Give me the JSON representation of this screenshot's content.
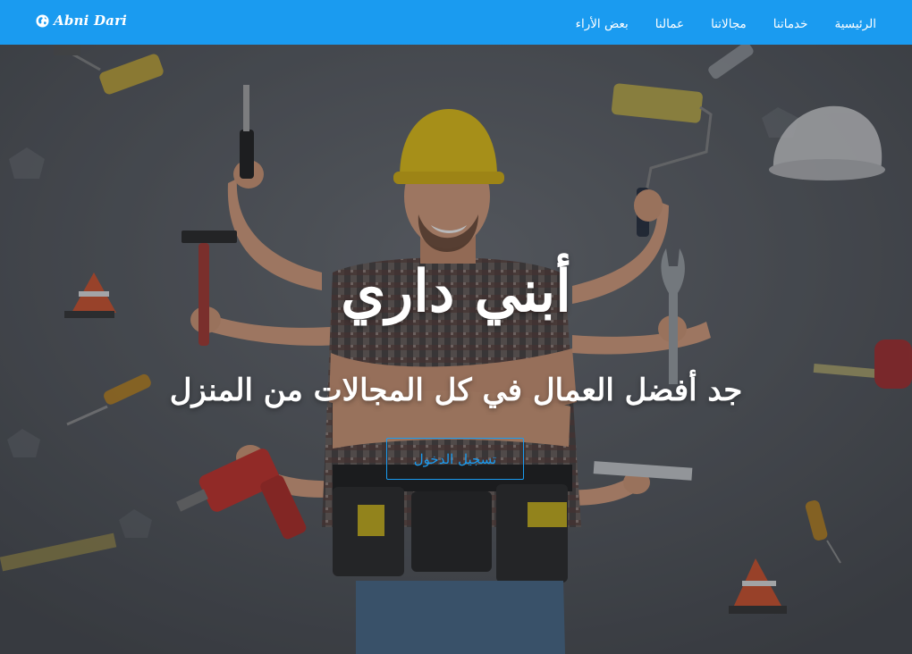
{
  "navbar": {
    "brand": "Abni Dari",
    "brand_icon": "globe-icon",
    "links": [
      {
        "label": "الرئيسية"
      },
      {
        "label": "خدماتنا"
      },
      {
        "label": "مجالاتنا"
      },
      {
        "label": "عمالنا"
      },
      {
        "label": "بعض الأراء"
      }
    ]
  },
  "hero": {
    "title": "أبني داري",
    "subtitle": "جد أفضل العمال في كل المجالات من المنزل",
    "cta_label": "تسجيل الدخول",
    "background_image": "worker-with-tools-photo"
  },
  "colors": {
    "primary": "#1a9bf0",
    "overlay": "#1b1e23"
  }
}
